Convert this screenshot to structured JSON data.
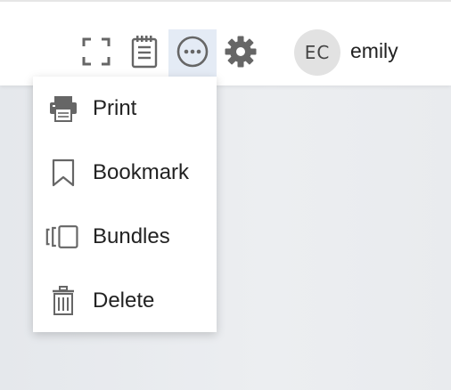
{
  "header": {
    "user": {
      "initials": "EC",
      "name": "emily"
    },
    "icons": [
      "fullscreen-icon",
      "notes-icon",
      "more-options-icon",
      "settings-icon"
    ]
  },
  "menu": {
    "items": [
      {
        "label": "Print",
        "icon": "print-icon"
      },
      {
        "label": "Bookmark",
        "icon": "bookmark-icon"
      },
      {
        "label": "Bundles",
        "icon": "bundles-icon"
      },
      {
        "label": "Delete",
        "icon": "trash-icon"
      }
    ]
  },
  "colors": {
    "active_button_bg": "#e4ebf5",
    "icon_gray": "#6b6b6b",
    "avatar_bg": "#e2e2e2"
  }
}
